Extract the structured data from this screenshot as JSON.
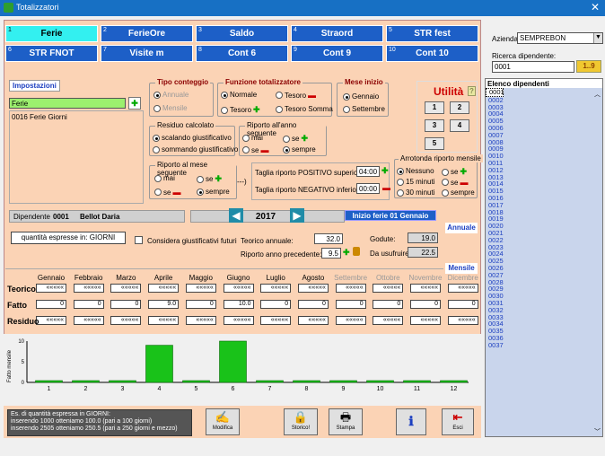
{
  "window": {
    "title": "Totalizzatori"
  },
  "tabs": [
    {
      "num": "1",
      "label": "Ferie",
      "selected": true
    },
    {
      "num": "2",
      "label": "FerieOre"
    },
    {
      "num": "3",
      "label": "Saldo"
    },
    {
      "num": "4",
      "label": "Straord"
    },
    {
      "num": "5",
      "label": "STR fest"
    },
    {
      "num": "6",
      "label": "STR FNOT"
    },
    {
      "num": "7",
      "label": "Visite m"
    },
    {
      "num": "8",
      "label": "Cont 6"
    },
    {
      "num": "9",
      "label": "Cont 9"
    },
    {
      "num": "10",
      "label": "Cont 10"
    }
  ],
  "impostazioni": {
    "title": "Impostazioni",
    "field": "Ferie",
    "list": [
      "0016   Ferie Giorni"
    ]
  },
  "tipo": {
    "title": "Tipo conteggio",
    "opt1": "Annuale",
    "opt2": "Mensile"
  },
  "funzione": {
    "title": "Funzione totalizzatore",
    "opt1": "Normale",
    "opt2": "Tesoro",
    "opt3": "Tesoro",
    "opt4": "Tesoro Somma"
  },
  "mese": {
    "title": "Mese inizio",
    "opt1": "Gennaio",
    "opt2": "Settembre"
  },
  "utilita": {
    "title": "Utilità",
    "help": "?",
    "b1": "1",
    "b2": "2",
    "b3": "3",
    "b4": "4",
    "b5": "5"
  },
  "residuo": {
    "title": "Residuo calcolato",
    "opt1": "scalando giustificativo",
    "opt2": "sommando giustificativo"
  },
  "riporto_anno": {
    "title": "Riporto all'anno seguente",
    "opt1": "mai",
    "opt2": "se",
    "opt3": "se",
    "opt4": "sempre"
  },
  "riporto_mese": {
    "title": "Riporto al mese seguente",
    "opt1": "mai",
    "opt2": "se",
    "opt3": "se",
    "opt4": "sempre",
    "arrow": "---)"
  },
  "taglia": {
    "pos_label": "Taglia riporto POSITIVO superiore a:",
    "pos_val": "04:00",
    "neg_label": "Taglia riporto NEGATIVO inferiore a:",
    "neg_val": "00:00"
  },
  "arrotonda": {
    "title": "Arrotonda riporto mensile",
    "opt1": "Nessuno",
    "opt2": "se",
    "opt3": "15 minuti",
    "opt4": "se",
    "opt5": "30 minuti",
    "opt6": "sempre"
  },
  "dipendente": {
    "label": "Dipendente",
    "code": "0001",
    "name": "Bellot  Daria",
    "year": "2017",
    "inizio": "Inizio ferie 01 Gennaio"
  },
  "annuale": {
    "title": "Annuale",
    "quantita": "quantità espresse in: GIORNI",
    "considera": "Considera giustificativi futuri",
    "teorico_label": "Teorico annuale:",
    "teorico": "32.0",
    "riporto_label": "Riporto anno precedente:",
    "riporto": "9.5",
    "goduto_label": "Godute:",
    "goduto": "19.0",
    "usufruire_label": "Da usufruire:",
    "usufruire": "22.5"
  },
  "mensile": {
    "title": "Mensile",
    "months": [
      "Gennaio",
      "Febbraio",
      "Marzo",
      "Aprile",
      "Maggio",
      "Giugno",
      "Luglio",
      "Agosto",
      "Settembre",
      "Ottobre",
      "Novembre",
      "Dicembre"
    ],
    "rows": [
      "Teorico",
      "Fatto",
      "Residuo"
    ],
    "teorico": [
      "«««««",
      "«««««",
      "«««««",
      "«««««",
      "«««««",
      "«««««",
      "«««««",
      "«««««",
      "«««««",
      "«««««",
      "«««««",
      "«««««"
    ],
    "fatto": [
      "0",
      "0",
      "0",
      "9.0",
      "0",
      "10.0",
      "0",
      "0",
      "0",
      "0",
      "0",
      "0"
    ],
    "residuo": [
      "«««««",
      "«««««",
      "«««««",
      "«««««",
      "«««««",
      "«««««",
      "«««««",
      "«««««",
      "«««««",
      "«««««",
      "«««««",
      "«««««"
    ]
  },
  "chart_data": {
    "type": "bar",
    "categories": [
      "1",
      "2",
      "3",
      "4",
      "5",
      "6",
      "7",
      "8",
      "9",
      "10",
      "11",
      "12"
    ],
    "values": [
      0,
      0,
      0,
      9,
      0,
      10,
      0,
      0,
      0,
      0,
      0,
      0
    ],
    "ylabel": "Fatto mensile",
    "yticks": [
      "10",
      "5",
      "0"
    ],
    "ylim": [
      0,
      10
    ]
  },
  "info": {
    "l1": "Es. di quantità espressa in GIORNI:",
    "l2": "inserendo  1000  otteniamo  100.0    (pari a  100 giorni)",
    "l3": "inserendo  2505  otteniamo  250.5    (pari a  250 giorni e mezzo)"
  },
  "actions": {
    "modifica": "Modifica",
    "storico": "Storico!",
    "stampa": "Stampa",
    "esci": "Esci"
  },
  "azienda": {
    "label": "Azienda:",
    "value": "SEMPREBON"
  },
  "ricerca": {
    "label": "Ricerca dipendente:",
    "value": "0001",
    "btn": "1..9"
  },
  "elenco": {
    "title": "Elenco dipendenti",
    "items": [
      "0001",
      "0002",
      "0003",
      "0004",
      "0005",
      "0006",
      "0007",
      "0008",
      "0009",
      "0010",
      "0011",
      "0012",
      "0013",
      "0014",
      "0015",
      "0016",
      "0017",
      "0018",
      "0019",
      "0020",
      "0021",
      "0022",
      "0023",
      "0024",
      "0025",
      "0026",
      "0027",
      "0028",
      "0029",
      "0030",
      "0031",
      "0032",
      "0033",
      "0034",
      "0035",
      "0036",
      "0037"
    ]
  }
}
